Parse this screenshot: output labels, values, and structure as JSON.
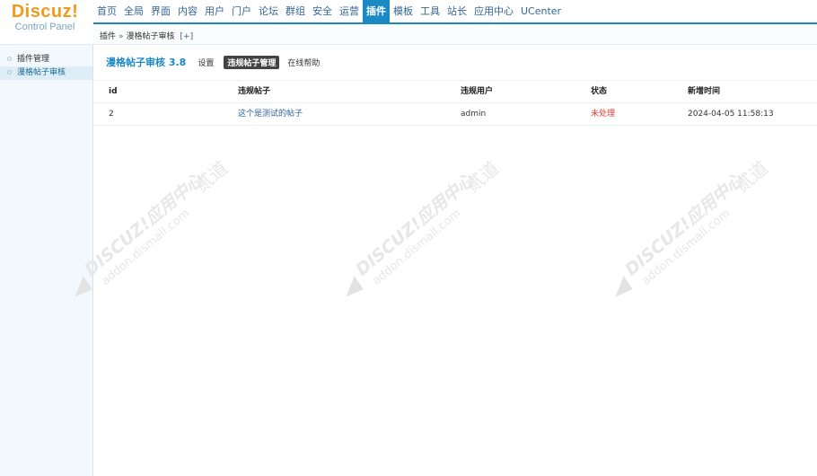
{
  "logo": {
    "main": "Discuz!",
    "sub": "Control Panel"
  },
  "topnav": {
    "items": [
      "首页",
      "全局",
      "界面",
      "内容",
      "用户",
      "门户",
      "论坛",
      "群组",
      "安全",
      "运营",
      "插件",
      "模板",
      "工具",
      "站长",
      "应用中心",
      "UCenter"
    ],
    "active_index": 10
  },
  "breadcrumb": {
    "root": "插件",
    "separator": "»",
    "current": "漫格帖子审核",
    "add": "[+]"
  },
  "sidebar": {
    "items": [
      "插件管理",
      "漫格帖子审核"
    ],
    "active_index": 1
  },
  "main": {
    "title": "漫格帖子审核 3.8",
    "tabs": [
      "设置",
      "违规帖子管理",
      "在线帮助"
    ],
    "active_tab": 1
  },
  "table": {
    "headers": [
      "id",
      "违规帖子",
      "违规用户",
      "状态",
      "新增时间"
    ],
    "rows": [
      {
        "id": "2",
        "post": "这个是测试的帖子",
        "user": "admin",
        "status": "未处理",
        "time": "2024-04-05 11:58:13"
      }
    ]
  },
  "watermark": {
    "line1": "DISCUZ!应用中心",
    "line2": "addon.dismall.com",
    "brand": "贰道"
  },
  "colors": {
    "accent": "#1b8ac4",
    "logo": "#f19a1c",
    "status_red": "#e23a3a",
    "link": "#336699"
  }
}
